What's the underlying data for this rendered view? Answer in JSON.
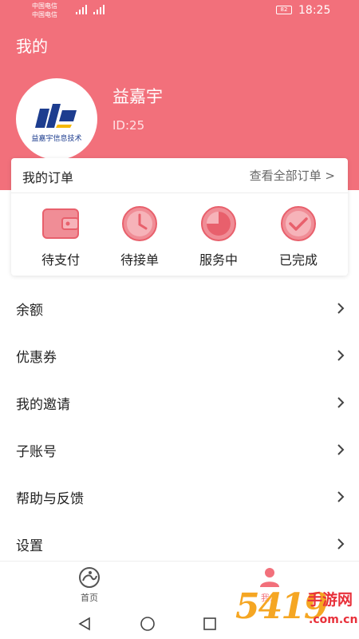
{
  "status_bar": {
    "carrier_1": "中国电信",
    "carrier_2": "中国电信",
    "battery": "82",
    "time": "18:25"
  },
  "header": {
    "title": "我的",
    "logo_text": "益嘉宇信息技术",
    "user_name": "益嘉宇",
    "user_id": "ID:25"
  },
  "orders": {
    "title": "我的订单",
    "view_all": "查看全部订单 >",
    "items": [
      {
        "label": "待支付",
        "icon": "wallet-icon"
      },
      {
        "label": "待接单",
        "icon": "clock-icon"
      },
      {
        "label": "服务中",
        "icon": "timer-icon"
      },
      {
        "label": "已完成",
        "icon": "check-circle-icon"
      }
    ]
  },
  "menu": {
    "items": [
      {
        "label": "余额"
      },
      {
        "label": "优惠券"
      },
      {
        "label": "我的邀请"
      },
      {
        "label": "子账号"
      },
      {
        "label": "帮助与反馈"
      },
      {
        "label": "设置"
      }
    ]
  },
  "tabbar": {
    "home_label": "首页",
    "mine_label": "我的"
  },
  "watermark": {
    "number": "5419",
    "text": "手游网",
    "url": ".com.cn"
  },
  "colors": {
    "brand": "#f2707b",
    "icon_fill": "#f08d96",
    "icon_stroke": "#e8606c",
    "tab_inactive": "#555555"
  }
}
